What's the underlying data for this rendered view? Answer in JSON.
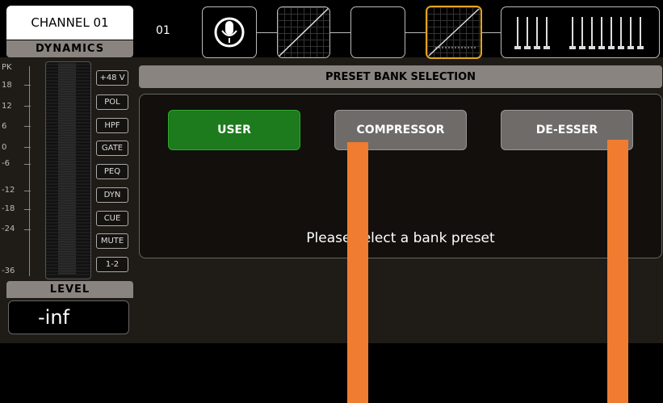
{
  "channel": {
    "name": "CHANNEL 01",
    "number": "01",
    "section": "DYNAMICS"
  },
  "meter": {
    "scale": [
      "PK",
      "18",
      "12",
      "6",
      "0",
      "-6",
      "-12",
      "-18",
      "-24",
      "-36"
    ],
    "level_label": "LEVEL",
    "level_value": "-inf"
  },
  "strip_buttons": [
    "+48 V",
    "POL",
    "HPF",
    "GATE",
    "PEQ",
    "DYN",
    "CUE",
    "MUTE",
    "1-2"
  ],
  "preset": {
    "header": "PRESET BANK SELECTION",
    "banks": [
      "USER",
      "COMPRESSOR",
      "DE-ESSER"
    ],
    "prompt": "Please select a bank preset"
  },
  "icons": {
    "mic": "microphone-icon"
  },
  "colors": {
    "selected": "#e6a51e",
    "user_bank": "#1d7a1d",
    "overlay": "#ef7c30"
  }
}
